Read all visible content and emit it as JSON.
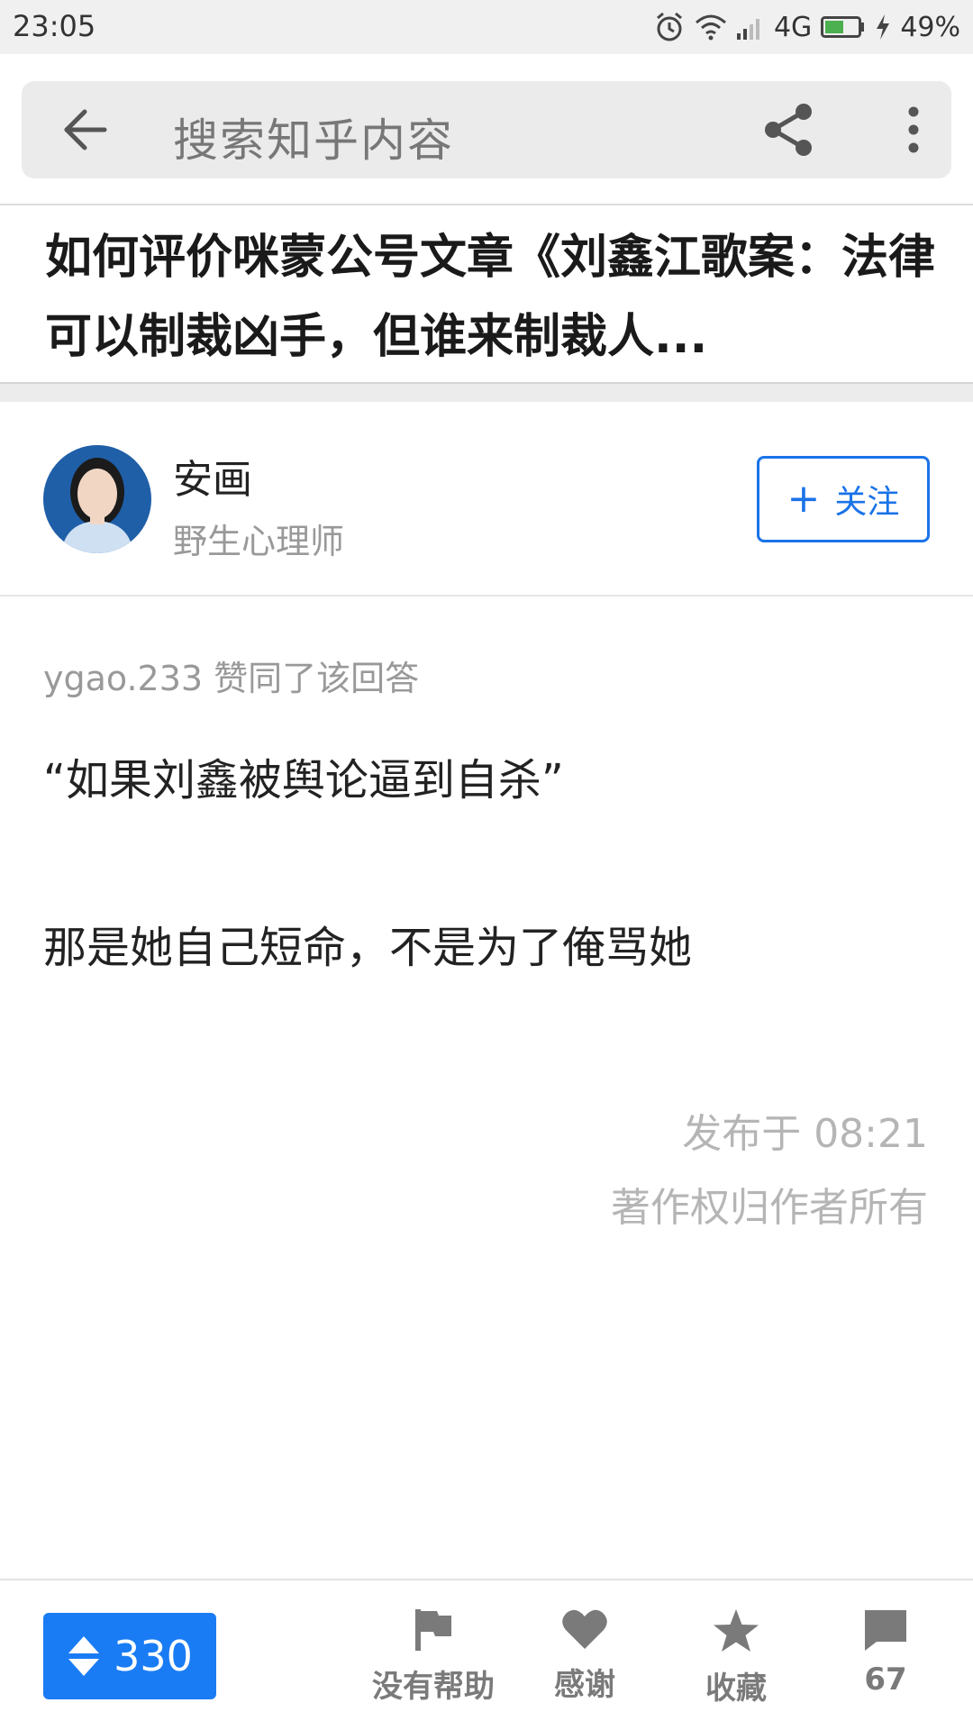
{
  "status_bar": {
    "time": "23:05",
    "network": "4G",
    "battery": "49%",
    "icons": [
      "alarm-icon",
      "wifi-icon",
      "signal-icon",
      "battery-icon",
      "charging-icon"
    ]
  },
  "search": {
    "placeholder": "搜索知乎内容",
    "icons": [
      "back-arrow-icon",
      "share-icon",
      "more-vertical-icon"
    ]
  },
  "question": {
    "title": "如何评价咪蒙公号文章《刘鑫江歌案：法律可以制裁凶手，但谁来制裁人..."
  },
  "author": {
    "name": "安画",
    "bio": "野生心理师",
    "follow_label": "关注",
    "avatar_icon": "avatar-photo"
  },
  "answer": {
    "vote_note": "ygao.233 赞同了该回答",
    "paragraph1": "“如果刘鑫被舆论逼到自杀”",
    "paragraph2": "那是她自己短命，不是为了俺骂她",
    "published": "发布于 08:21",
    "copyright": "著作权归作者所有"
  },
  "bottom_bar": {
    "upvote_count": "330",
    "actions": [
      {
        "label": "没有帮助",
        "icon": "flag-icon"
      },
      {
        "label": "感谢",
        "icon": "heart-icon"
      },
      {
        "label": "收藏",
        "icon": "star-icon"
      },
      {
        "label": "67",
        "icon": "comment-icon"
      }
    ]
  },
  "colors": {
    "accent": "#1a7cf4",
    "follow_border": "#1a73e8",
    "muted_text": "#999999"
  }
}
